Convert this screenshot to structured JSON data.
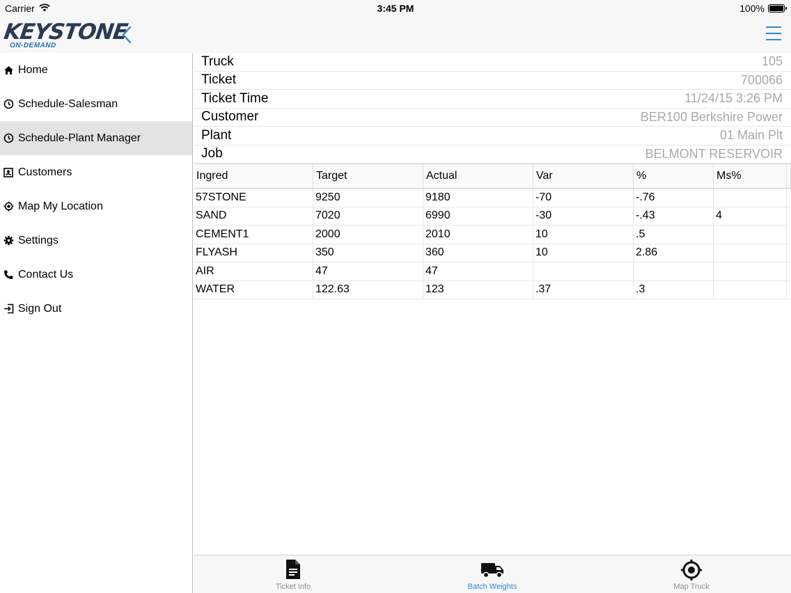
{
  "status_bar": {
    "carrier": "Carrier",
    "time": "3:45 PM",
    "battery": "100%"
  },
  "navbar": {
    "logo_text": "KEYSTONE",
    "logo_sub": "ON-DEMAND"
  },
  "sidebar": {
    "items": [
      {
        "label": "Home",
        "icon": "home-icon"
      },
      {
        "label": "Schedule-Salesman",
        "icon": "clock-icon"
      },
      {
        "label": "Schedule-Plant Manager",
        "icon": "clock-icon",
        "active": true
      },
      {
        "label": "Customers",
        "icon": "contact-card-icon"
      },
      {
        "label": "Map My Location",
        "icon": "location-target-icon"
      },
      {
        "label": "Settings",
        "icon": "gear-icon"
      },
      {
        "label": "Contact Us",
        "icon": "phone-icon"
      },
      {
        "label": "Sign Out",
        "icon": "sign-out-icon"
      }
    ]
  },
  "ticket": {
    "fields": [
      {
        "label": "Truck",
        "value": "105"
      },
      {
        "label": "Ticket",
        "value": "700066"
      },
      {
        "label": "Ticket Time",
        "value": "11/24/15 3:26 PM"
      },
      {
        "label": "Customer",
        "value": "BER100 Berkshire Power"
      },
      {
        "label": "Plant",
        "value": "01 Main Plt"
      },
      {
        "label": "Job",
        "value": "BELMONT RESERVOIR"
      }
    ]
  },
  "batch": {
    "headers": [
      "Ingred",
      "Target",
      "Actual",
      "Var",
      "%",
      "Ms%"
    ],
    "rows": [
      [
        "57STONE",
        "9250",
        "9180",
        "-70",
        "-.76",
        ""
      ],
      [
        "SAND",
        "7020",
        "6990",
        "-30",
        "-.43",
        "4"
      ],
      [
        "CEMENT1",
        "2000",
        "2010",
        "10",
        ".5",
        ""
      ],
      [
        "FLYASH",
        "350",
        "360",
        "10",
        "2.86",
        ""
      ],
      [
        "AIR",
        "47",
        "47",
        "",
        "",
        ""
      ],
      [
        "WATER",
        "122.63",
        "123",
        ".37",
        ".3",
        ""
      ]
    ]
  },
  "tabs": [
    {
      "label": "Ticket Info",
      "icon": "document-icon"
    },
    {
      "label": "Batch Weights",
      "icon": "truck-icon",
      "active": true
    },
    {
      "label": "Map Truck",
      "icon": "map-target-icon"
    }
  ],
  "colors": {
    "accent": "#2f86d6",
    "logo": "#2b3a55",
    "active_row": "#e3e3e3"
  }
}
